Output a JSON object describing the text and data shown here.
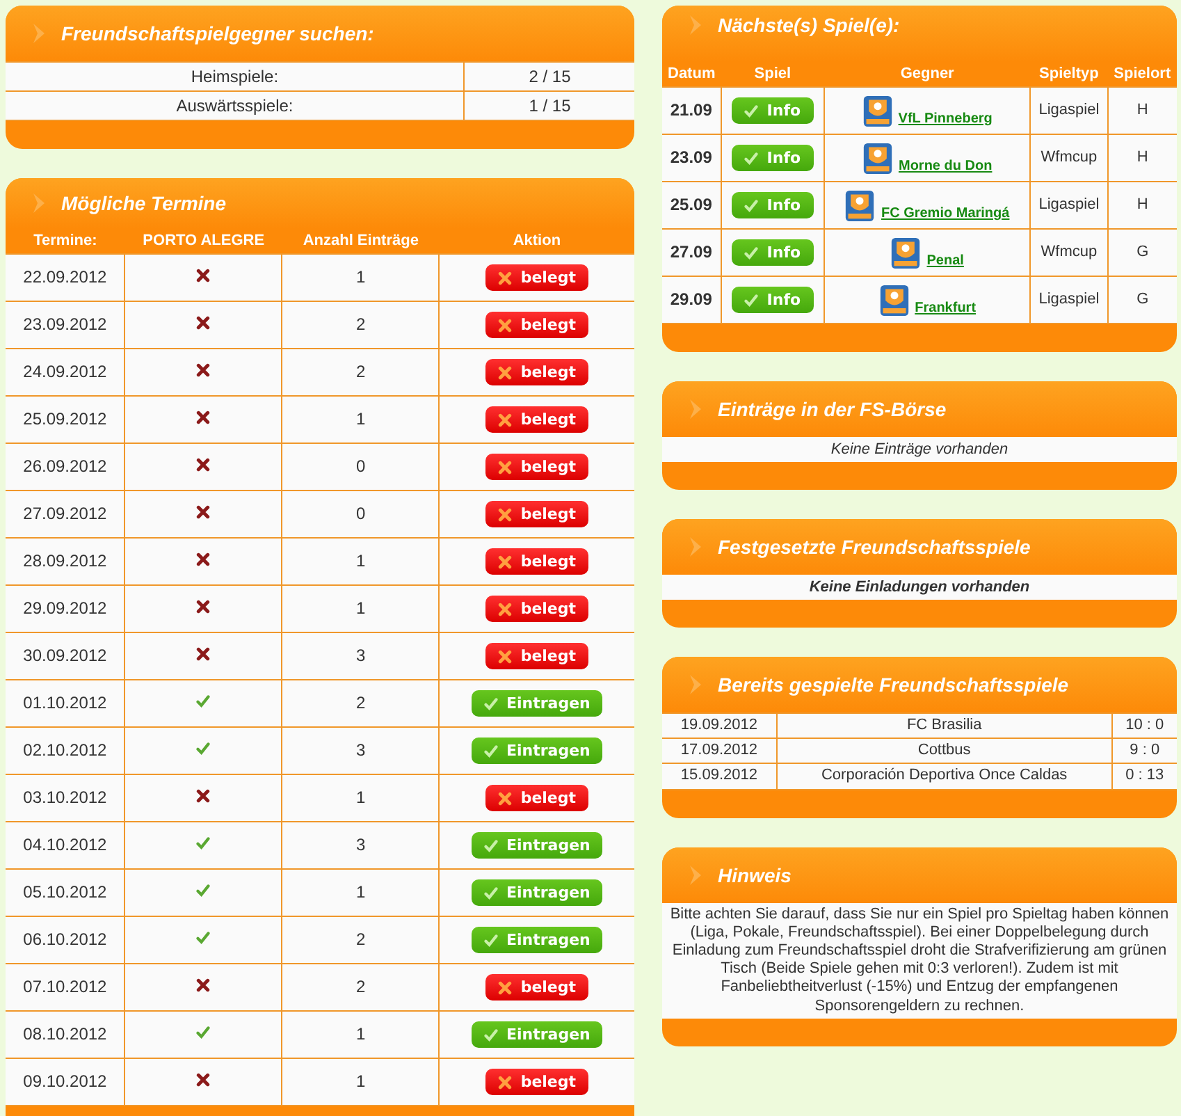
{
  "search_panel": {
    "title": "Freundschaftspielgegner suchen:",
    "rows": [
      {
        "label": "Heimspiele:",
        "value": "2 / 15"
      },
      {
        "label": "Auswärtsspiele:",
        "value": "1 / 15"
      }
    ]
  },
  "dates_panel": {
    "title": "Mögliche Termine",
    "columns": [
      "Termine:",
      "PORTO ALEGRE",
      "Anzahl Einträge",
      "Aktion"
    ],
    "rows": [
      {
        "date": "22.09.2012",
        "available": false,
        "count": "1",
        "action": "belegt"
      },
      {
        "date": "23.09.2012",
        "available": false,
        "count": "2",
        "action": "belegt"
      },
      {
        "date": "24.09.2012",
        "available": false,
        "count": "2",
        "action": "belegt"
      },
      {
        "date": "25.09.2012",
        "available": false,
        "count": "1",
        "action": "belegt"
      },
      {
        "date": "26.09.2012",
        "available": false,
        "count": "0",
        "action": "belegt"
      },
      {
        "date": "27.09.2012",
        "available": false,
        "count": "0",
        "action": "belegt"
      },
      {
        "date": "28.09.2012",
        "available": false,
        "count": "1",
        "action": "belegt"
      },
      {
        "date": "29.09.2012",
        "available": false,
        "count": "1",
        "action": "belegt"
      },
      {
        "date": "30.09.2012",
        "available": false,
        "count": "3",
        "action": "belegt"
      },
      {
        "date": "01.10.2012",
        "available": true,
        "count": "2",
        "action": "Eintragen"
      },
      {
        "date": "02.10.2012",
        "available": true,
        "count": "3",
        "action": "Eintragen"
      },
      {
        "date": "03.10.2012",
        "available": false,
        "count": "1",
        "action": "belegt"
      },
      {
        "date": "04.10.2012",
        "available": true,
        "count": "3",
        "action": "Eintragen"
      },
      {
        "date": "05.10.2012",
        "available": true,
        "count": "1",
        "action": "Eintragen"
      },
      {
        "date": "06.10.2012",
        "available": true,
        "count": "2",
        "action": "Eintragen"
      },
      {
        "date": "07.10.2012",
        "available": false,
        "count": "2",
        "action": "belegt"
      },
      {
        "date": "08.10.2012",
        "available": true,
        "count": "1",
        "action": "Eintragen"
      },
      {
        "date": "09.10.2012",
        "available": false,
        "count": "1",
        "action": "belegt"
      }
    ]
  },
  "next_games_panel": {
    "title": "Nächste(s) Spiel(e):",
    "columns": [
      "Datum",
      "Spiel",
      "Gegner",
      "Spieltyp",
      "Spielort"
    ],
    "rows": [
      {
        "date": "21.09",
        "button": "Info",
        "opponent": "VfL Pinneberg",
        "type": "Ligaspiel",
        "venue": "H"
      },
      {
        "date": "23.09",
        "button": "Info",
        "opponent": "Morne du Don",
        "type": "Wfmcup",
        "venue": "H"
      },
      {
        "date": "25.09",
        "button": "Info",
        "opponent": "FC Gremio Maringá",
        "type": "Ligaspiel",
        "venue": "H"
      },
      {
        "date": "27.09",
        "button": "Info",
        "opponent": "Penal",
        "type": "Wfmcup",
        "venue": "G"
      },
      {
        "date": "29.09",
        "button": "Info",
        "opponent": "Frankfurt",
        "type": "Ligaspiel",
        "venue": "G"
      }
    ]
  },
  "exchange_panel": {
    "title": "Einträge in der FS-Börse",
    "message": "Keine Einträge vorhanden"
  },
  "fixed_panel": {
    "title": "Festgesetzte Freundschaftsspiele",
    "message": "Keine Einladungen vorhanden"
  },
  "played_panel": {
    "title": "Bereits gespielte Freundschaftsspiele",
    "rows": [
      {
        "date": "19.09.2012",
        "opponent": "FC Brasilia",
        "score": "10 : 0"
      },
      {
        "date": "17.09.2012",
        "opponent": "Cottbus",
        "score": "9 : 0"
      },
      {
        "date": "15.09.2012",
        "opponent": "Corporación Deportiva Once Caldas",
        "score": "0 : 13"
      }
    ]
  },
  "note_panel": {
    "title": "Hinweis",
    "text": "Bitte achten Sie darauf, dass Sie nur ein Spiel pro Spieltag haben können (Liga, Pokale, Freundschaftsspiel). Bei einer Doppelbelegung durch Einladung zum Freundschaftsspiel droht die Strafverifizierung am grünen Tisch (Beide Spiele gehen mit 0:3 verloren!). Zudem ist mit Fanbeliebtheitverlust (-15%) und Entzug der empfangenen Sponsorengeldern zu rechnen."
  }
}
